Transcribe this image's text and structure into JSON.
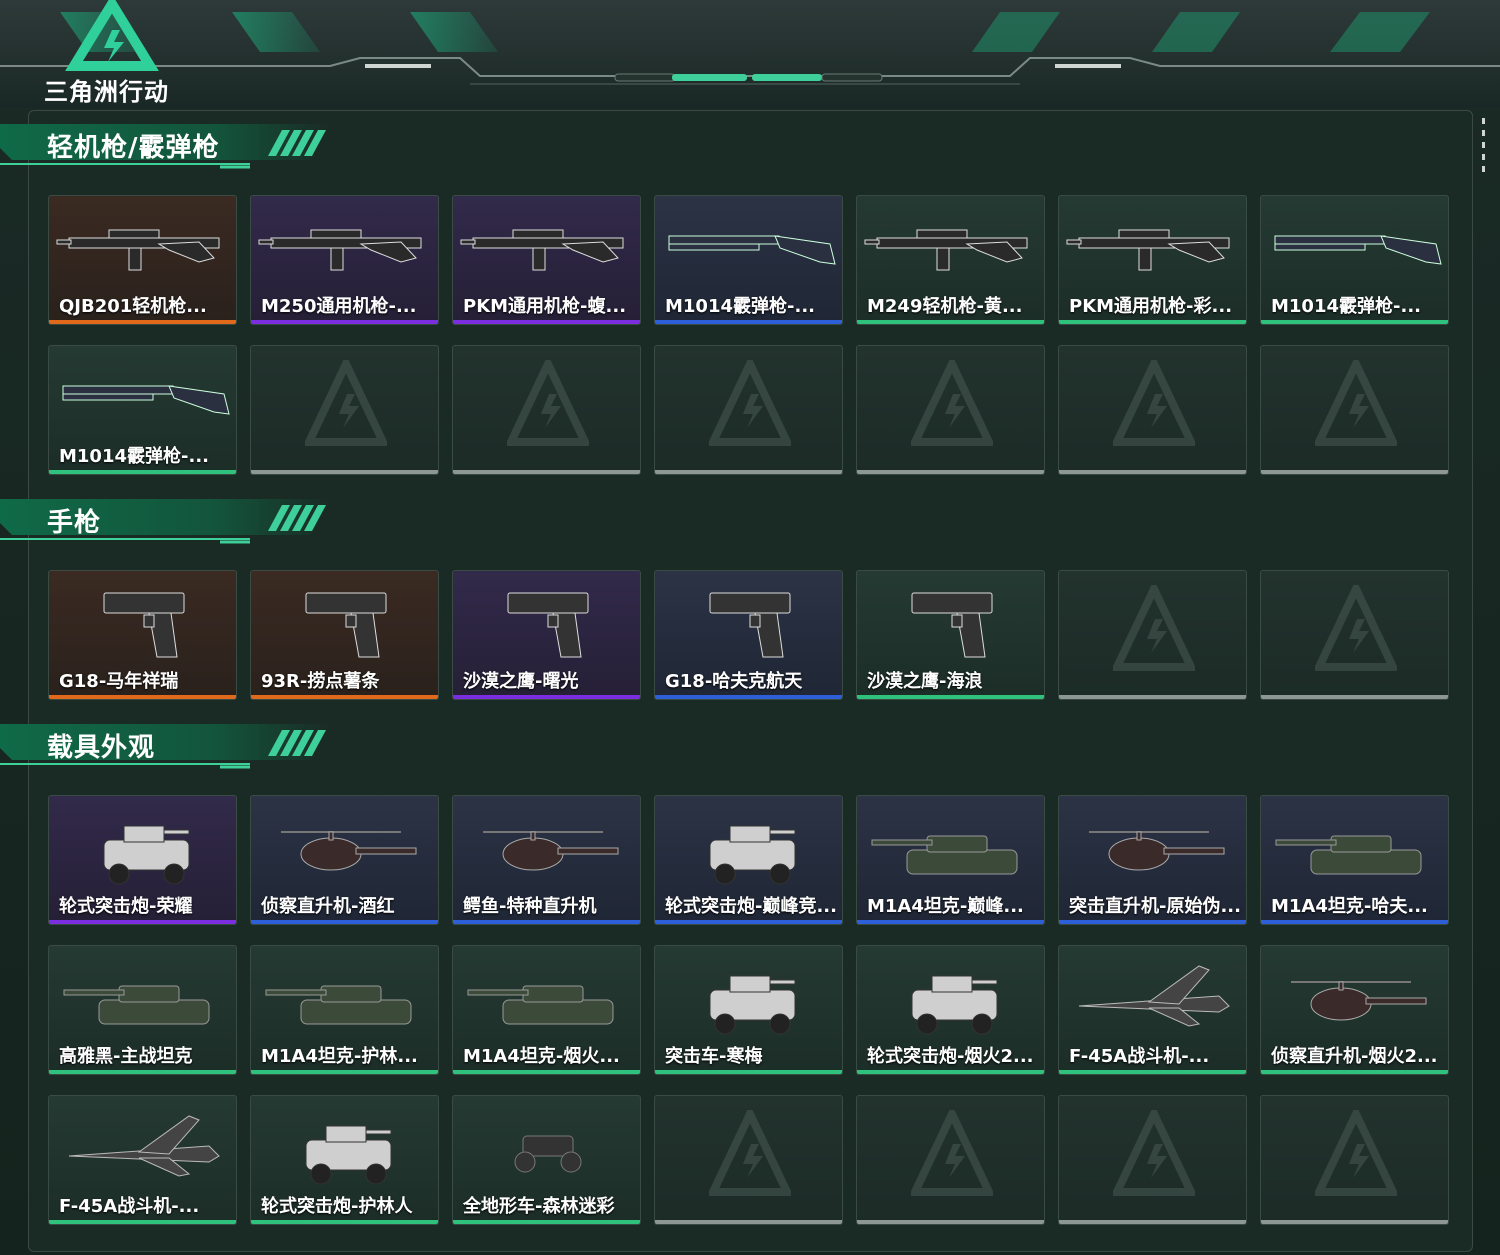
{
  "header": {
    "logo_text": "三角洲行动"
  },
  "colors": {
    "orange": "#e0691b",
    "purple": "#7a2ee0",
    "blue": "#2d5fd8",
    "green": "#2fc27c",
    "gray": "#8d9793"
  },
  "sections": [
    {
      "title": "轻机枪/霰弹枪"
    },
    {
      "title": "手枪"
    },
    {
      "title": "载具外观"
    }
  ],
  "lmg_items": [
    {
      "label": "QJB201轻机枪...",
      "rarity": "orange",
      "icon": "lmg-icon"
    },
    {
      "label": "M250通用机枪-...",
      "rarity": "purple",
      "icon": "lmg-icon"
    },
    {
      "label": "PKM通用机枪-蝮...",
      "rarity": "purple",
      "icon": "lmg-icon"
    },
    {
      "label": "M1014霰弹枪-...",
      "rarity": "blue",
      "icon": "shotgun-icon"
    },
    {
      "label": "M249轻机枪-黄...",
      "rarity": "green",
      "icon": "lmg-icon"
    },
    {
      "label": "PKM通用机枪-彩...",
      "rarity": "green",
      "icon": "lmg-icon"
    },
    {
      "label": "M1014霰弹枪-...",
      "rarity": "green",
      "icon": "shotgun-icon"
    },
    {
      "label": "M1014霰弹枪-...",
      "rarity": "green",
      "icon": "shotgun-icon"
    }
  ],
  "pistol_items": [
    {
      "label": "G18-马年祥瑞",
      "rarity": "orange",
      "icon": "pistol-icon"
    },
    {
      "label": "93R-捞点薯条",
      "rarity": "orange",
      "icon": "pistol-icon"
    },
    {
      "label": "沙漠之鹰-曙光",
      "rarity": "purple",
      "icon": "pistol-icon"
    },
    {
      "label": "G18-哈夫克航天",
      "rarity": "blue",
      "icon": "pistol-icon"
    },
    {
      "label": "沙漠之鹰-海浪",
      "rarity": "green",
      "icon": "pistol-icon"
    }
  ],
  "vehicle_items": [
    {
      "label": "轮式突击炮-荣耀",
      "rarity": "purple",
      "icon": "armored-car-icon"
    },
    {
      "label": "侦察直升机-酒红",
      "rarity": "blue",
      "icon": "helicopter-icon"
    },
    {
      "label": "鳄鱼-特种直升机",
      "rarity": "blue",
      "icon": "helicopter-icon"
    },
    {
      "label": "轮式突击炮-巅峰竞...",
      "rarity": "blue",
      "icon": "armored-car-icon"
    },
    {
      "label": "M1A4坦克-巅峰...",
      "rarity": "blue",
      "icon": "tank-icon"
    },
    {
      "label": "突击直升机-原始伪...",
      "rarity": "blue",
      "icon": "helicopter-icon"
    },
    {
      "label": "M1A4坦克-哈夫...",
      "rarity": "blue",
      "icon": "tank-icon"
    },
    {
      "label": "高雅黑-主战坦克",
      "rarity": "green",
      "icon": "tank-icon"
    },
    {
      "label": "M1A4坦克-护林...",
      "rarity": "green",
      "icon": "tank-icon"
    },
    {
      "label": "M1A4坦克-烟火...",
      "rarity": "green",
      "icon": "tank-icon"
    },
    {
      "label": "突击车-寒梅",
      "rarity": "green",
      "icon": "armored-car-icon"
    },
    {
      "label": "轮式突击炮-烟火2...",
      "rarity": "green",
      "icon": "armored-car-icon"
    },
    {
      "label": "F-45A战斗机-...",
      "rarity": "green",
      "icon": "jet-icon"
    },
    {
      "label": "侦察直升机-烟火2...",
      "rarity": "green",
      "icon": "helicopter-icon"
    },
    {
      "label": "F-45A战斗机-...",
      "rarity": "green",
      "icon": "jet-icon"
    },
    {
      "label": "轮式突击炮-护林人",
      "rarity": "green",
      "icon": "armored-car-icon"
    },
    {
      "label": "全地形车-森林迷彩",
      "rarity": "green",
      "icon": "atv-icon"
    }
  ]
}
